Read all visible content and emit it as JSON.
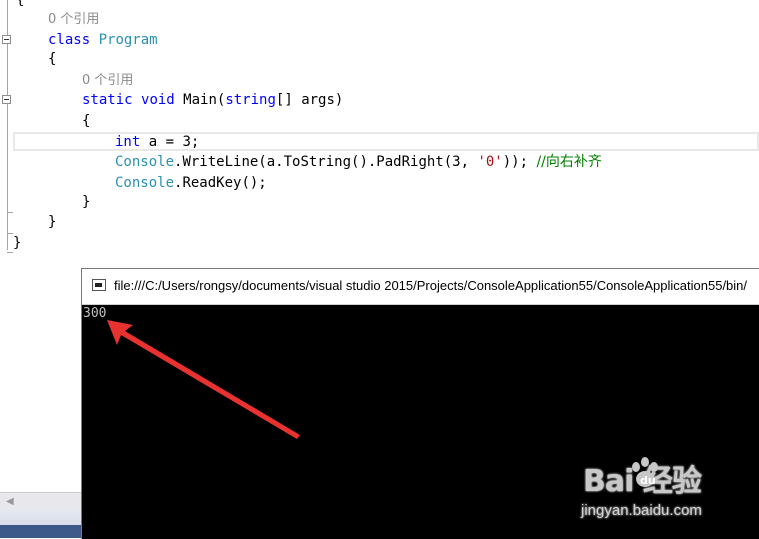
{
  "editor": {
    "lines": {
      "brace_open_top": "{",
      "ref1": "0 个引用",
      "class_kw": "class",
      "class_name": "Program",
      "brace_class_open": "{",
      "ref2": "0 个引用",
      "static_kw": "static",
      "void_kw": "void",
      "method_name": "Main(",
      "string_kw": "string",
      "params_rest": "[] args)",
      "brace_method_open": "{",
      "int_kw": "int",
      "int_rest": " a = 3;",
      "console1": "Console",
      "writeline_rest": ".WriteLine(a.ToString().PadRight(3, ",
      "char_literal": "'0'",
      "writeline_end": ")); ",
      "comment": "//向右补齐",
      "console2": "Console",
      "readkey_rest": ".ReadKey();",
      "brace_method_close": "}",
      "brace_class_close": "}",
      "brace_ns_close": "}"
    }
  },
  "console_window": {
    "title": "file:///C:/Users/rongsy/documents/visual studio 2015/Projects/ConsoleApplication55/ConsoleApplication55/bin/",
    "output": "300"
  },
  "watermark": {
    "logo": "Bai  经验",
    "url": "jingyan.baidu.com"
  },
  "colors": {
    "keyword": "#0000ff",
    "type": "#2b91af",
    "string": "#a31515",
    "comment": "#008000",
    "arrow": "#e8322f"
  }
}
